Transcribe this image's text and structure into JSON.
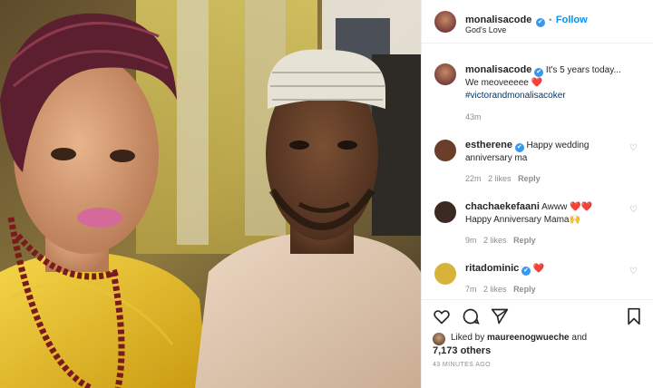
{
  "header": {
    "username": "monalisacode",
    "verified_glyph": "✔",
    "follow_separator": "•",
    "follow_label": "Follow",
    "location": "God's Love"
  },
  "caption": {
    "username": "monalisacode",
    "text_line1": "It's 5 years today...",
    "text_line2": "We meoveeeee ❤️",
    "hashtag": "#victorandmonalisacoker",
    "time": "43m"
  },
  "comments": [
    {
      "username": "estherene",
      "text_start": "Happy wedding",
      "text_end": "anniversary ma",
      "time": "22m",
      "likes": "2 likes",
      "reply": "Reply",
      "avatar_color": "#6b3e2a"
    },
    {
      "username": "chachaekefaani",
      "text_start": "Awww ❤️❤️",
      "text_end": "Happy Anniversary Mama🙌",
      "time": "9m",
      "likes": "2 likes",
      "reply": "Reply",
      "avatar_color": "#3a2a22"
    },
    {
      "username": "ritadominic",
      "text_start": "❤️",
      "text_end": "",
      "time": "7m",
      "likes": "2 likes",
      "reply": "Reply",
      "avatar_color": "#d9b23a"
    }
  ],
  "actions": {
    "liked_by_prefix": "Liked by",
    "liked_by_user": "maureenogwueche",
    "liked_by_and": "and",
    "others": "7,173 others",
    "timestamp": "43 MINUTES AGO"
  },
  "icons": [
    "heart-icon",
    "comment-icon",
    "share-icon",
    "bookmark-icon",
    "like-heart-icon"
  ],
  "colors": {
    "accent": "#0095f6",
    "verified": "#3897f0",
    "heart_red": "#ed4956",
    "hashtag": "#00376b"
  }
}
